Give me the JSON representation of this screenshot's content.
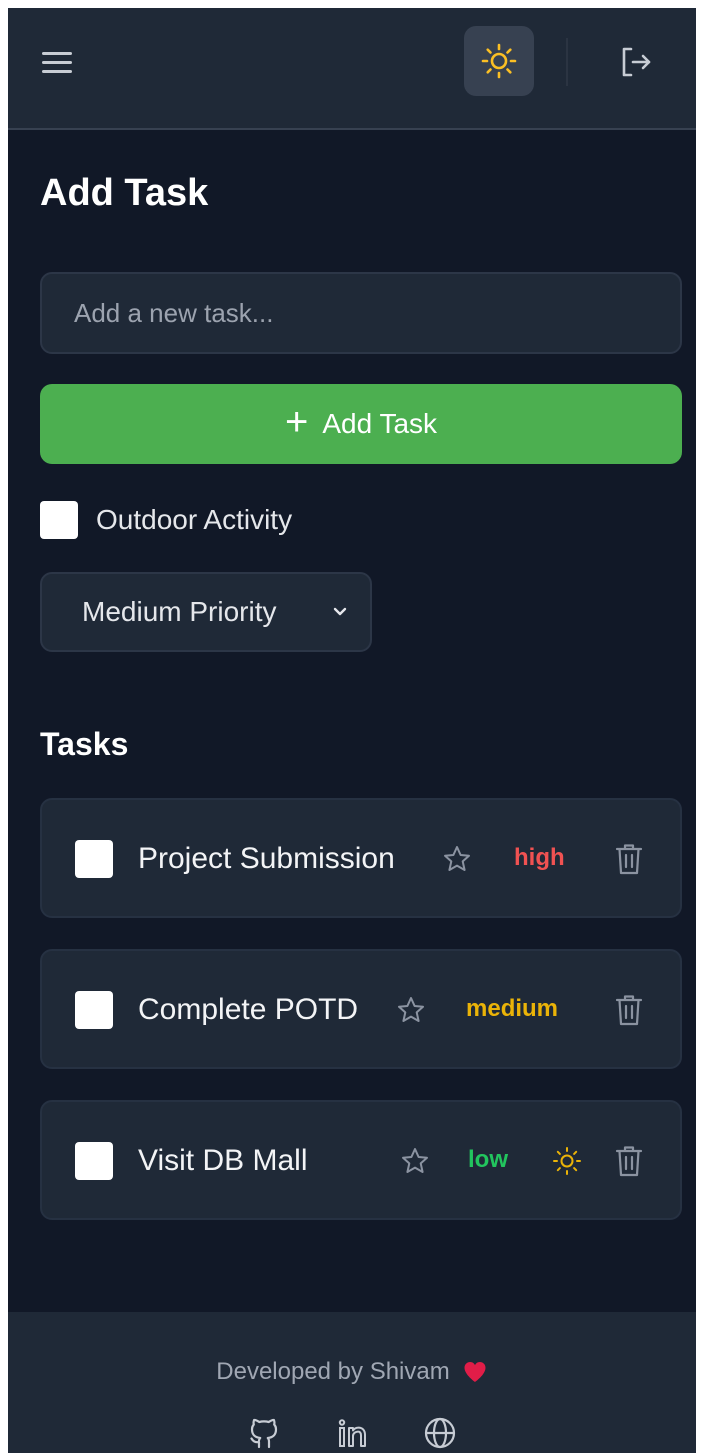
{
  "header": {
    "menu_icon": "hamburger-menu-icon",
    "theme_icon": "sun-icon",
    "logout_icon": "logout-icon"
  },
  "add_section": {
    "title": "Add Task",
    "input_placeholder": "Add a new task...",
    "input_value": "",
    "add_button_plus": "+",
    "add_button_label": "Add Task",
    "outdoor_label": "Outdoor Activity",
    "priority_selected": "Medium Priority"
  },
  "tasks_section": {
    "title": "Tasks",
    "items": [
      {
        "text": "Project Submission",
        "priority": "high",
        "outdoor": false
      },
      {
        "text": "Complete POTD",
        "priority": "medium",
        "outdoor": false
      },
      {
        "text": "Visit DB Mall",
        "priority": "low",
        "outdoor": true
      }
    ]
  },
  "footer": {
    "credit": "Developed by Shivam",
    "heart_icon": "heart-icon",
    "links": [
      "github-icon",
      "linkedin-icon",
      "globe-icon"
    ]
  },
  "colors": {
    "background": "#111827",
    "surface": "#1f2937",
    "accent_green": "#4caf50",
    "high": "#f05252",
    "medium": "#eab308",
    "low": "#22c55e",
    "sun": "#fbbf24",
    "heart": "#e11d48"
  }
}
